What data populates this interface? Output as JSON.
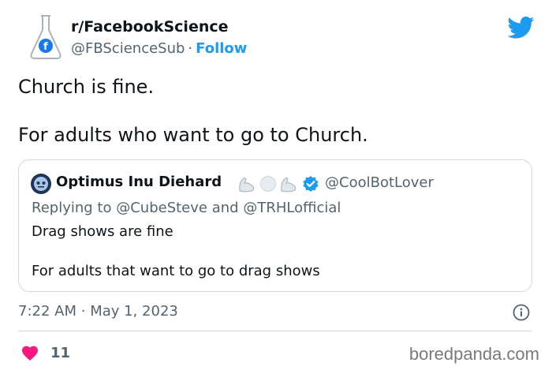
{
  "header": {
    "account_name": "r/FacebookScience",
    "handle": "@FBScienceSub",
    "separator": "·",
    "follow_label": "Follow"
  },
  "tweet": {
    "lines": [
      "Church is fine.",
      "For adults who want to go to Church."
    ]
  },
  "quote": {
    "author_name": "Optimus Inu Diehard",
    "author_handle": "@CoolBotLover",
    "reply_prefix": "Replying to",
    "reply_mention_1": "@CubeSteve",
    "reply_and": "and",
    "reply_mention_2": "@TRHLofficial",
    "lines": [
      "Drag shows are fine",
      "For adults that want to go to drag shows"
    ]
  },
  "footer": {
    "time": "7:22 AM",
    "separator": "·",
    "date": "May 1, 2023",
    "like_count": "11"
  },
  "watermark": "boredpanda.com",
  "colors": {
    "accent": "#1d9bf0",
    "heart": "#f91880",
    "secondary_text": "#536471",
    "border": "#cfd9de"
  },
  "icons": [
    "flask-icon",
    "facebook-icon",
    "twitter-bird-icon",
    "robot-avatar-icon",
    "flexed-arm-icon",
    "white-circle-icon",
    "verified-badge-icon",
    "info-icon",
    "heart-icon"
  ]
}
